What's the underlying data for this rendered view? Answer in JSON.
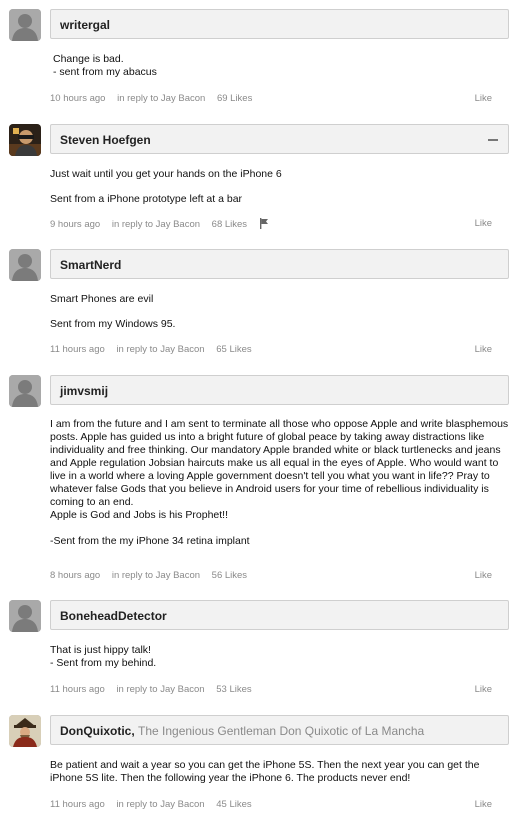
{
  "comments": [
    {
      "username": "writergal",
      "title": "",
      "avatar": "default-avatar",
      "paragraphs": [
        "Change is bad.\n- sent from my abacus"
      ],
      "time": "10 hours ago",
      "reply_to": "in reply to Jay Bacon",
      "likes": "69 Likes",
      "like_label": "Like"
    },
    {
      "username": "Steven Hoefgen",
      "title": "",
      "avatar": "photo-avatar",
      "paragraphs": [
        "Just wait until you get your hands on the iPhone 6",
        "Sent from a iPhone prototype left at a bar"
      ],
      "time": "9 hours ago",
      "reply_to": "in reply to Jay Bacon",
      "likes": "68 Likes",
      "like_label": "Like"
    },
    {
      "username": "SmartNerd",
      "title": "",
      "avatar": "default-avatar",
      "paragraphs": [
        "Smart Phones are evil",
        "Sent from my Windows 95."
      ],
      "time": "11 hours ago",
      "reply_to": "in reply to Jay Bacon",
      "likes": "65 Likes",
      "like_label": "Like"
    },
    {
      "username": "jimvsmij",
      "title": "",
      "avatar": "default-avatar",
      "paragraphs": [
        "I am from the future and I am sent to terminate all those who oppose Apple and write blasphemous posts. Apple has guided us into a bright future of global peace by taking away distractions like individuality and free thinking.  Our mandatory Apple branded white or black turtlenecks and jeans and Apple regulation Jobsian haircuts make us all equal in the eyes of Apple.  Who would want to live in a world where a loving Apple government doesn't tell you what you want in life?? Pray to whatever false Gods that you believe in Android users for your time of rebellious individuality is coming to an end.\nApple is God and Jobs is his Prophet!!",
        "-Sent from the my iPhone 34 retina implant"
      ],
      "time": "8 hours ago",
      "reply_to": "in reply to Jay Bacon",
      "likes": "56 Likes",
      "like_label": "Like"
    },
    {
      "username": "BoneheadDetector",
      "title": "",
      "avatar": "default-avatar",
      "paragraphs": [
        "That is just hippy talk!\n- Sent from my behind."
      ],
      "time": "11 hours ago",
      "reply_to": "in reply to Jay Bacon",
      "likes": "53 Likes",
      "like_label": "Like"
    },
    {
      "username": "DonQuixotic,",
      "title": "The Ingenious Gentleman Don Quixotic of La Mancha",
      "avatar": "portrait-avatar",
      "paragraphs": [
        "Be patient and wait a year so you can get the iPhone 5S.  Then the next year you can get the iPhone 5S lite.  Then the following year the iPhone 6.  The products never end!"
      ],
      "time": "11 hours ago",
      "reply_to": "in reply to Jay Bacon",
      "likes": "45 Likes",
      "like_label": "Like"
    }
  ],
  "icons": {
    "collapse": "minus-icon",
    "flag": "flag-icon"
  },
  "colors": {
    "header_bg": "#f2f2f2",
    "header_border": "#cfcfcf",
    "meta_text": "#8a8a8a",
    "title_text": "#8a8a8a"
  }
}
